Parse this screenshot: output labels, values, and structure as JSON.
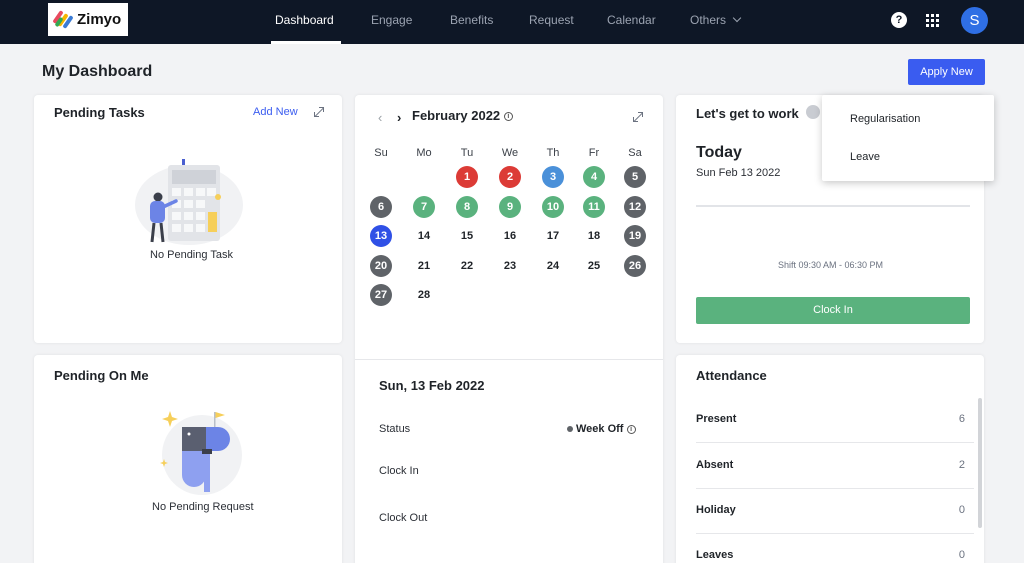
{
  "brand": {
    "name": "Zimyo"
  },
  "nav": {
    "items": [
      {
        "label": "Dashboard"
      },
      {
        "label": "Engage"
      },
      {
        "label": "Benefits"
      },
      {
        "label": "Request"
      },
      {
        "label": "Calendar"
      },
      {
        "label": "Others"
      }
    ],
    "help_label": "?",
    "avatar_initial": "S"
  },
  "page": {
    "title": "My Dashboard",
    "apply_label": "Apply New"
  },
  "dropdown": {
    "items": [
      {
        "label": "Regularisation"
      },
      {
        "label": "Leave"
      }
    ]
  },
  "pending_tasks": {
    "title": "Pending Tasks",
    "add_label": "Add New",
    "empty_text": "No Pending Task"
  },
  "pending_on_me": {
    "title": "Pending On Me",
    "empty_text": "No Pending Request"
  },
  "calendar": {
    "month_label": "February 2022",
    "weekdays": [
      "Su",
      "Mo",
      "Tu",
      "We",
      "Th",
      "Fr",
      "Sa"
    ],
    "days": [
      {
        "d": "1",
        "col": 2,
        "row": 0,
        "status": "absent"
      },
      {
        "d": "2",
        "col": 3,
        "row": 0,
        "status": "absent"
      },
      {
        "d": "3",
        "col": 4,
        "row": 0,
        "status": "holiday"
      },
      {
        "d": "4",
        "col": 5,
        "row": 0,
        "status": "present"
      },
      {
        "d": "5",
        "col": 6,
        "row": 0,
        "status": "weekoff"
      },
      {
        "d": "6",
        "col": 0,
        "row": 1,
        "status": "weekoff"
      },
      {
        "d": "7",
        "col": 1,
        "row": 1,
        "status": "present"
      },
      {
        "d": "8",
        "col": 2,
        "row": 1,
        "status": "present"
      },
      {
        "d": "9",
        "col": 3,
        "row": 1,
        "status": "present"
      },
      {
        "d": "10",
        "col": 4,
        "row": 1,
        "status": "present"
      },
      {
        "d": "11",
        "col": 5,
        "row": 1,
        "status": "present"
      },
      {
        "d": "12",
        "col": 6,
        "row": 1,
        "status": "weekoff"
      },
      {
        "d": "13",
        "col": 0,
        "row": 2,
        "status": "today"
      },
      {
        "d": "14",
        "col": 1,
        "row": 2,
        "status": ""
      },
      {
        "d": "15",
        "col": 2,
        "row": 2,
        "status": ""
      },
      {
        "d": "16",
        "col": 3,
        "row": 2,
        "status": ""
      },
      {
        "d": "17",
        "col": 4,
        "row": 2,
        "status": ""
      },
      {
        "d": "18",
        "col": 5,
        "row": 2,
        "status": ""
      },
      {
        "d": "19",
        "col": 6,
        "row": 2,
        "status": "weekoff"
      },
      {
        "d": "20",
        "col": 0,
        "row": 3,
        "status": "weekoff"
      },
      {
        "d": "21",
        "col": 1,
        "row": 3,
        "status": ""
      },
      {
        "d": "22",
        "col": 2,
        "row": 3,
        "status": ""
      },
      {
        "d": "23",
        "col": 3,
        "row": 3,
        "status": ""
      },
      {
        "d": "24",
        "col": 4,
        "row": 3,
        "status": ""
      },
      {
        "d": "25",
        "col": 5,
        "row": 3,
        "status": ""
      },
      {
        "d": "26",
        "col": 6,
        "row": 3,
        "status": "weekoff"
      },
      {
        "d": "27",
        "col": 0,
        "row": 4,
        "status": "weekoff"
      },
      {
        "d": "28",
        "col": 1,
        "row": 4,
        "status": ""
      }
    ],
    "colors": {
      "absent": "#dc3b36",
      "holiday": "#4a90d9",
      "present": "#5ab27e",
      "weekoff": "#5f6368",
      "today": "#2f50e6"
    }
  },
  "day_detail": {
    "date_label": "Sun, 13 Feb 2022",
    "status_label": "Status",
    "status_value": "Week Off",
    "clock_in_label": "Clock In",
    "clock_out_label": "Clock Out"
  },
  "work": {
    "title": "Let's get to work",
    "today_label": "Today",
    "date": "Sun Feb 13 2022",
    "shift": "Shift 09:30 AM - 06:30 PM",
    "clock_in_button": "Clock In"
  },
  "attendance": {
    "title": "Attendance",
    "rows": [
      {
        "label": "Present",
        "value": "6"
      },
      {
        "label": "Absent",
        "value": "2"
      },
      {
        "label": "Holiday",
        "value": "0"
      },
      {
        "label": "Leaves",
        "value": "0"
      }
    ]
  }
}
